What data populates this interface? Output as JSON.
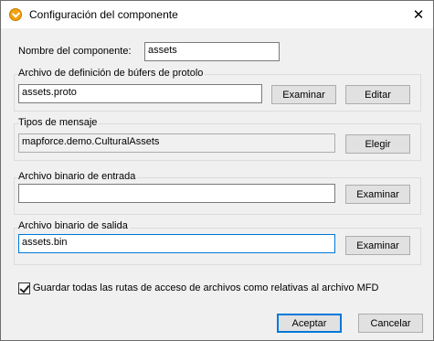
{
  "window": {
    "title": "Configuración del componente"
  },
  "name": {
    "label": "Nombre del componente:",
    "value": "assets"
  },
  "proto": {
    "label": "Archivo de definición de búfers de protolo",
    "value": "assets.proto",
    "browse": "Examinar",
    "edit": "Editar"
  },
  "message": {
    "label": "Tipos de mensaje",
    "value": "mapforce.demo.CulturalAssets",
    "choose": "Elegir"
  },
  "input_file": {
    "label": "Archivo binario de entrada",
    "value": "",
    "browse": "Examinar"
  },
  "output_file": {
    "label": "Archivo binario de salida",
    "value": "assets.bin",
    "browse": "Examinar"
  },
  "relative_paths": {
    "label": "Guardar todas las rutas de acceso de archivos como relativas al archivo MFD",
    "checked": true
  },
  "actions": {
    "ok": "Aceptar",
    "cancel": "Cancelar"
  },
  "icons": {
    "app": "mapforce-app-icon",
    "close": "close-icon"
  }
}
